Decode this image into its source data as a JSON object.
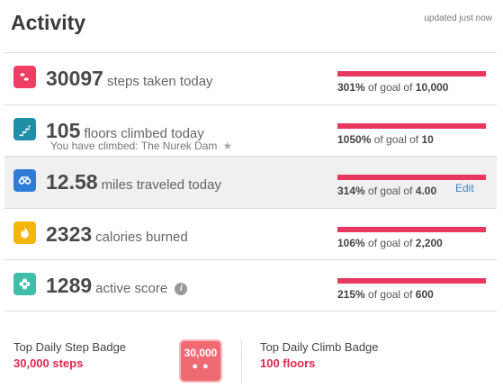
{
  "header": {
    "title": "Activity",
    "updated": "updated just now"
  },
  "colors": {
    "steps": "#ee3e63",
    "floors": "#1e8fa6",
    "distance": "#2f7bd8",
    "calories": "#f5b50f",
    "active": "#3fbfa9",
    "goal_bar": "#e8385f",
    "badge": "#f06a73",
    "badge_text": "#e0264f",
    "edit_link": "#3a86c8"
  },
  "rows": [
    {
      "icon": "footsteps-icon",
      "value": "30097",
      "label": "steps taken today",
      "percent": "301%",
      "goal_prefix": "of goal of",
      "goal": "10,000",
      "progress": 3.01
    },
    {
      "icon": "stairs-icon",
      "value": "105",
      "label": "floors climbed today",
      "sub": "You have climbed: The Nurek Dam",
      "percent": "1050%",
      "goal_prefix": "of goal of",
      "goal": "10",
      "progress": 10.5
    },
    {
      "icon": "distance-icon",
      "value": "12.58",
      "label": "miles traveled today",
      "percent": "314%",
      "goal_prefix": "of goal of",
      "goal": "4.00",
      "edit": "Edit",
      "progress": 3.14
    },
    {
      "icon": "flame-icon",
      "value": "2323",
      "label": "calories burned",
      "percent": "106%",
      "goal_prefix": "of goal of",
      "goal": "2,200",
      "progress": 1.06
    },
    {
      "icon": "flower-icon",
      "value": "1289",
      "label": "active score",
      "info": "i",
      "percent": "215%",
      "goal_prefix": "of goal of",
      "goal": "600",
      "progress": 2.15
    }
  ],
  "badges": {
    "step": {
      "title": "Top Daily Step Badge",
      "value": "30,000 steps",
      "icon_text": "30,000"
    },
    "climb": {
      "title": "Top Daily Climb Badge",
      "value": "100 floors"
    }
  }
}
